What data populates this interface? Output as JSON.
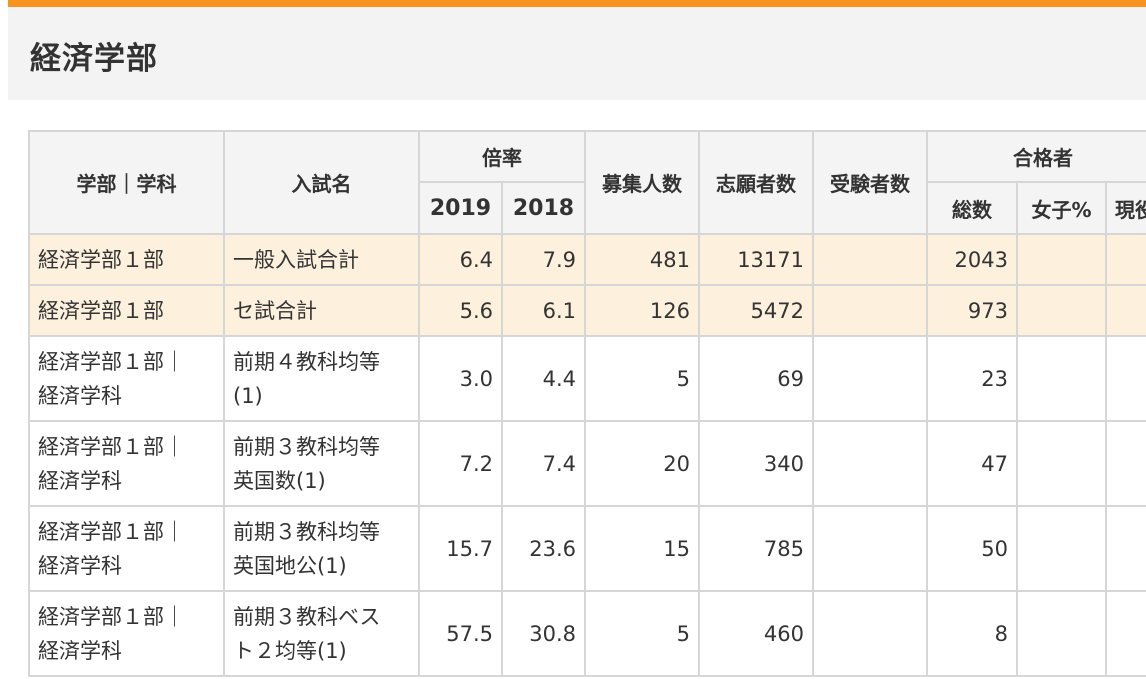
{
  "page": {
    "title": "経済学部"
  },
  "table": {
    "headers": {
      "faculty": "学部｜学科",
      "exam_name": "入試名",
      "ratio": "倍率",
      "ratio_2019": "2019",
      "ratio_2018": "2018",
      "capacity": "募集人数",
      "applicants": "志願者数",
      "examinees": "受験者数",
      "passers": "合格者",
      "passers_total": "総数",
      "passers_female": "女子%",
      "passers_current": "現役"
    },
    "rows": [
      {
        "faculty": "経済学部１部",
        "exam": "一般入試合計",
        "r2019": "6.4",
        "r2018": "7.9",
        "capacity": "481",
        "applicants": "13171",
        "examinees": "",
        "total": "2043",
        "female": "",
        "current": ""
      },
      {
        "faculty": "経済学部１部",
        "exam": "セ試合計",
        "r2019": "5.6",
        "r2018": "6.1",
        "capacity": "126",
        "applicants": "5472",
        "examinees": "",
        "total": "973",
        "female": "",
        "current": ""
      },
      {
        "faculty_line1": "経済学部１部｜",
        "faculty_line2": "経済学科",
        "exam_line1": "前期４教科均等",
        "exam_line2": "(1)",
        "r2019": "3.0",
        "r2018": "4.4",
        "capacity": "5",
        "applicants": "69",
        "examinees": "",
        "total": "23",
        "female": "",
        "current": ""
      },
      {
        "faculty_line1": "経済学部１部｜",
        "faculty_line2": "経済学科",
        "exam_line1": "前期３教科均等",
        "exam_line2": "英国数(1)",
        "r2019": "7.2",
        "r2018": "7.4",
        "capacity": "20",
        "applicants": "340",
        "examinees": "",
        "total": "47",
        "female": "",
        "current": ""
      },
      {
        "faculty_line1": "経済学部１部｜",
        "faculty_line2": "経済学科",
        "exam_line1": "前期３教科均等",
        "exam_line2": "英国地公(1)",
        "r2019": "15.7",
        "r2018": "23.6",
        "capacity": "15",
        "applicants": "785",
        "examinees": "",
        "total": "50",
        "female": "",
        "current": ""
      },
      {
        "faculty_line1": "経済学部１部｜",
        "faculty_line2": "経済学科",
        "exam_line1": "前期３教科ベス",
        "exam_line2": "ト２均等(1)",
        "r2019": "57.5",
        "r2018": "30.8",
        "capacity": "5",
        "applicants": "460",
        "examinees": "",
        "total": "8",
        "female": "",
        "current": ""
      }
    ]
  },
  "colors": {
    "accent": "#f7931e",
    "highlight_row": "#fdf0dd",
    "header_bg": "#f4f4f4",
    "border": "#d6d6d6"
  }
}
